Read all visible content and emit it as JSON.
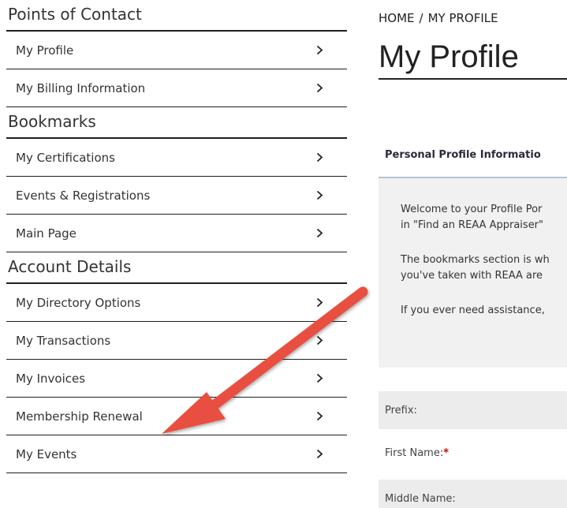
{
  "sidebar": {
    "sections": [
      {
        "title": "Points of Contact",
        "items": [
          {
            "label": "My Profile"
          },
          {
            "label": "My Billing Information"
          }
        ]
      },
      {
        "title": "Bookmarks",
        "items": [
          {
            "label": "My Certifications"
          },
          {
            "label": "Events & Registrations"
          },
          {
            "label": "Main Page"
          }
        ]
      },
      {
        "title": "Account Details",
        "items": [
          {
            "label": "My Directory Options"
          },
          {
            "label": "My Transactions"
          },
          {
            "label": "My Invoices"
          },
          {
            "label": "Membership Renewal"
          },
          {
            "label": "My Events"
          }
        ]
      }
    ]
  },
  "main": {
    "breadcrumb": {
      "home": "HOME",
      "separator": "/",
      "current": "MY PROFILE"
    },
    "title": "My Profile",
    "panel": {
      "header": "Personal Profile Informatio",
      "paragraphs": [
        {
          "line1": "Welcome to your Profile Por",
          "line2": "in \"Find an REAA Appraiser\""
        },
        {
          "line1": "The bookmarks section is wh",
          "line2": "you've taken with REAA are"
        },
        {
          "line1": "If you ever need assistance, ",
          "line2": ""
        }
      ]
    },
    "fields": {
      "prefix": "Prefix:",
      "first_name": "First Name:",
      "required_mark": "*",
      "middle_name": "Middle Name:"
    }
  },
  "annotation": {
    "type": "arrow",
    "color": "#e8503f",
    "icon": "annotation-arrow-icon"
  }
}
